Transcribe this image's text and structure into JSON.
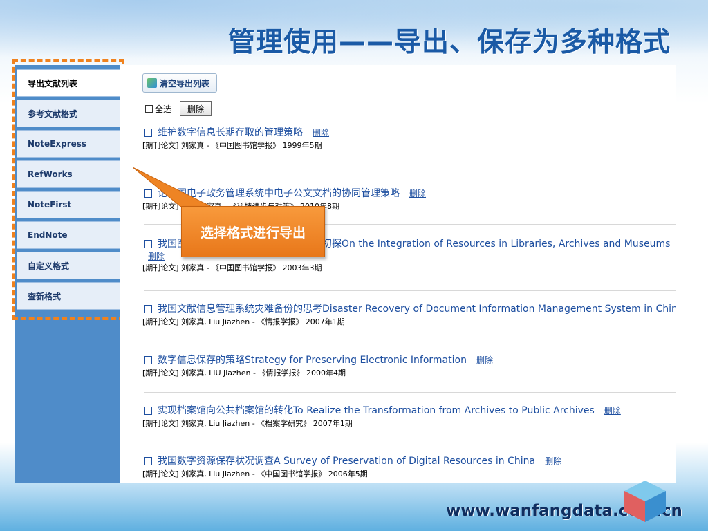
{
  "title": "管理使用——导出、保存为多种格式",
  "sidebar": {
    "items": [
      {
        "label": "导出文献列表"
      },
      {
        "label": "参考文献格式"
      },
      {
        "label": "NoteExpress"
      },
      {
        "label": "RefWorks"
      },
      {
        "label": "NoteFirst"
      },
      {
        "label": "EndNote"
      },
      {
        "label": "自定义格式"
      },
      {
        "label": "查新格式"
      }
    ]
  },
  "toolbar": {
    "clear_label": "清空导出列表",
    "select_all_label": "全选",
    "delete_label": "删除"
  },
  "records": [
    {
      "title": "维护数字信息长期存取的管理策略",
      "delete": "删除",
      "meta": "[期刊论文] 刘家真 - 《中国图书馆学报》 1999年5期"
    },
    {
      "title": "论我国电子政务管理系统中电子公文文档的协同管理策略",
      "delete": "删除",
      "meta": "[期刊论文] 詹晓 刘家真 - 《科技进步与对策》 2010年8期"
    },
    {
      "title": "我国图书馆、档案馆、博物馆资源整合初探On the Integration of Resources in Libraries, Archives and Museums",
      "delete": "删除",
      "meta": "[期刊论文] 刘家真 - 《中国图书馆学报》 2003年3期"
    },
    {
      "title": "我国文献信息管理系统灾难备份的思考Disaster Recovery of Document Information Management System in China",
      "delete": "",
      "meta": "[期刊论文] 刘家真, Liu Jiazhen - 《情报学报》 2007年1期"
    },
    {
      "title": "数字信息保存的策略Strategy for Preserving Electronic Information",
      "delete": "删除",
      "meta": "[期刊论文] 刘家真, LIU Jiazhen - 《情报学报》 2000年4期"
    },
    {
      "title": "实现档案馆向公共档案馆的转化To Realize the Transformation from Archives to Public Archives",
      "delete": "删除",
      "meta": "[期刊论文] 刘家真, Liu Jiazhen - 《档案学研究》 2007年1期"
    },
    {
      "title": "我国数字资源保存状况调查A Survey of Preservation of Digital Resources in China",
      "delete": "删除",
      "meta": "[期刊论文] 刘家真, Liu Jiazhen - 《中国图书馆学报》 2006年5期"
    }
  ],
  "callout": "选择格式进行导出",
  "footer_url": "www.wanfangdata.com.cn",
  "colors": {
    "accent": "#f0821e",
    "title": "#1a5aa6",
    "link": "#1e4fa0",
    "sidebar": "#4f8cc9"
  }
}
